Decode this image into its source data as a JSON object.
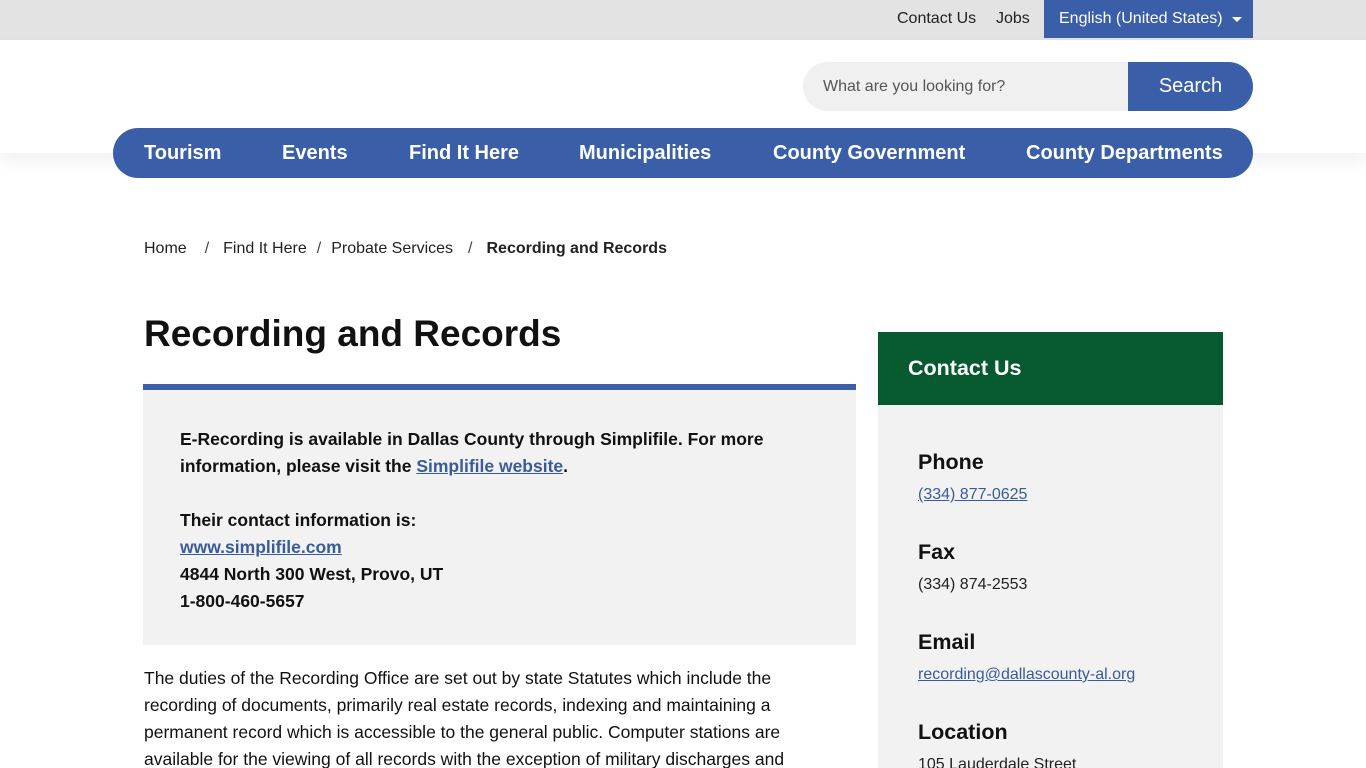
{
  "topbar": {
    "contact_label": "Contact Us",
    "jobs_label": "Jobs",
    "language_label": "English (United States)"
  },
  "search": {
    "placeholder": "What are you looking for?",
    "button_label": "Search"
  },
  "nav": {
    "items": [
      "Tourism",
      "Events",
      "Find It Here",
      "Municipalities",
      "County Government",
      "County Departments"
    ]
  },
  "breadcrumb": {
    "items": [
      "Home",
      "Find It Here",
      "Probate Services"
    ],
    "separator": "/",
    "current": "Recording and Records"
  },
  "page": {
    "title": "Recording and Records"
  },
  "notice": {
    "line1_text": "E-Recording is available in Dallas County through Simplifile. For more information, please visit the ",
    "line1_link": "Simplifile website",
    "line1_end": ".",
    "contact_heading": "Their contact information is:",
    "website": "www.simplifile.com",
    "address": "4844 North 300 West, Provo, UT",
    "phone": "1-800-460-5657"
  },
  "body": {
    "paragraph": "The duties of the Recording Office are set out by state Statutes which include the recording of documents, primarily real estate records, indexing and maintaining a permanent record which is accessible to the general public. Computer stations are available for the viewing of all records with the exception of military discharges and"
  },
  "sidebar": {
    "title": "Contact Us",
    "phone_label": "Phone",
    "phone_value": "(334) 877-0625",
    "fax_label": "Fax",
    "fax_value": "(334) 874-2553",
    "email_label": "Email",
    "email_value": "recording@dallascounty-al.org",
    "location_label": "Location",
    "location_value": "105 Lauderdale Street"
  },
  "colors": {
    "primary_blue": "#3a5ea8",
    "link_blue": "#3a5b9b",
    "contact_green": "#075a30",
    "panel_gray": "#f2f2f2"
  }
}
